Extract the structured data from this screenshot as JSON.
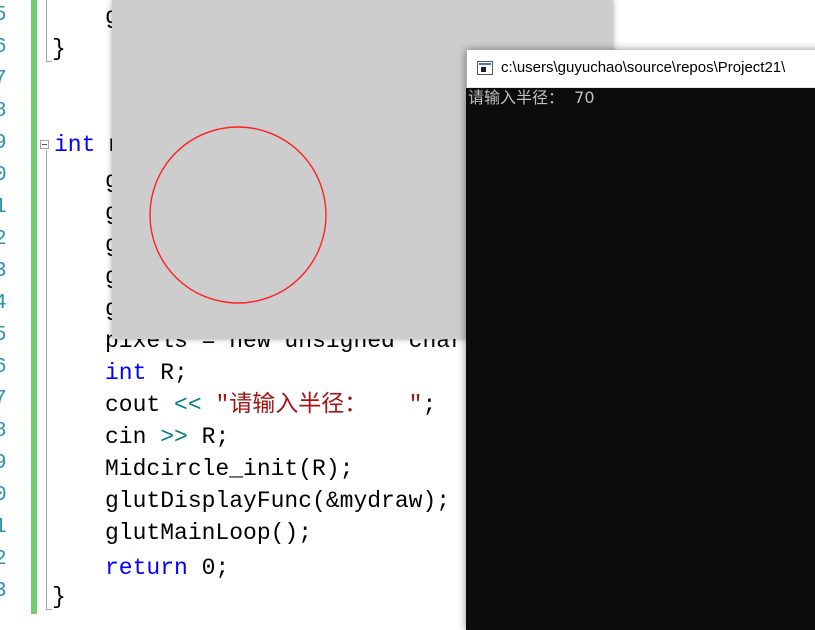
{
  "gutter": {
    "line_numbers": [
      "5",
      "6",
      "7",
      "8",
      "9",
      "0",
      "1",
      "2",
      "3",
      "4",
      "5",
      "6",
      "7",
      "8",
      "9",
      "0",
      "1",
      "2",
      "3"
    ]
  },
  "code": {
    "line_top_g": "g",
    "brace_close_1": "}",
    "line_int_main_kw": "int",
    "line_int_main_rest": " m",
    "hidden_g_lines": [
      "g",
      "g",
      "g",
      "g",
      "g"
    ],
    "pixels_line": "pixels = new unsigned char[w",
    "int_r_kw": "int",
    "int_r_rest": " R;",
    "cout_kw": "cout",
    "cout_op": " <<",
    "cout_str": " \"请输入半径：   \"",
    "cout_end": ";",
    "cin_kw": "cin",
    "cin_op": " >>",
    "cin_rest": " R;",
    "midcircle": "Midcircle_init(R);",
    "display_func": "glutDisplayFunc(&mydraw);",
    "main_loop": "glutMainLoop();",
    "return_kw": "return",
    "return_rest": " 0;",
    "brace_close_2": "}"
  },
  "glut": {
    "circle_color": "#ff2020",
    "background": "#cdcdcd"
  },
  "console": {
    "title": "c:\\users\\guyuchao\\source\\repos\\Project21\\",
    "output_line": "请输入半径：  70"
  }
}
